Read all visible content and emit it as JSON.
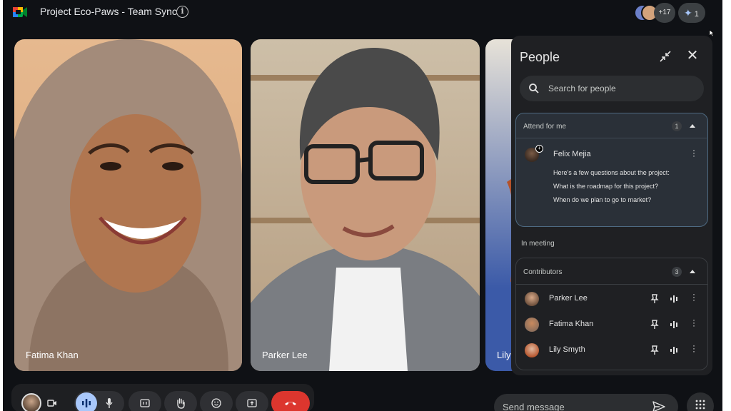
{
  "meeting": {
    "title": "Project Eco-Paws - Team Sync"
  },
  "header": {
    "more_participants": "+17",
    "gemini_count": "1"
  },
  "tiles": [
    {
      "name": "Fatima Khan"
    },
    {
      "name": "Parker Lee"
    },
    {
      "name": "Lily"
    }
  ],
  "people_panel": {
    "title": "People",
    "search_placeholder": "Search for people",
    "attend_for_me": {
      "label": "Attend for me",
      "count": "1",
      "person": "Felix Mejia",
      "note_lines": [
        "Here's a few questions about the project:",
        "What is the roadmap for this project?",
        "When do we plan to go to market?"
      ]
    },
    "in_meeting_label": "In meeting",
    "contributors": {
      "label": "Contributors",
      "count": "3",
      "people": [
        "Parker Lee",
        "Fatima Khan",
        "Lily Smyth"
      ]
    }
  },
  "chat": {
    "send_placeholder": "Send message"
  },
  "colors": {
    "accent": "#a8c7fa",
    "leave": "#dc362e",
    "panel": "#1f2023",
    "highlight_border": "#4e6a82"
  },
  "icons": [
    "meet-logo-icon",
    "info-icon",
    "collapse-icon",
    "close-icon",
    "search-icon",
    "pin-icon",
    "audio-icon",
    "more-vert-icon",
    "camera-icon",
    "mic-icon",
    "captions-icon",
    "raise-hand-icon",
    "emoji-icon",
    "present-icon",
    "leave-call-icon",
    "send-icon",
    "apps-icon"
  ]
}
